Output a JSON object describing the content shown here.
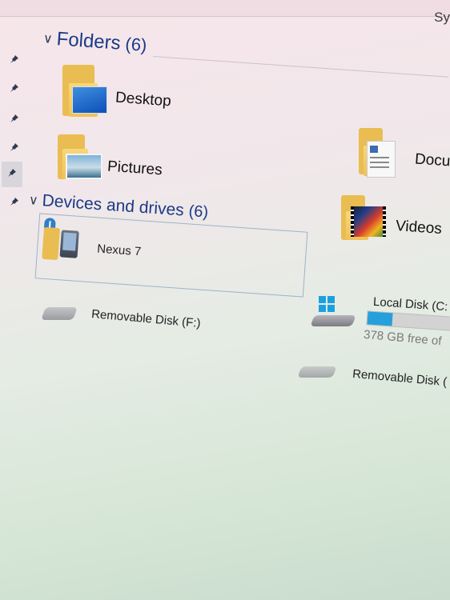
{
  "titlebar": {
    "partial_text": "Sy"
  },
  "folders": {
    "title": "Folders",
    "count": "(6)",
    "items": [
      {
        "label": "Desktop",
        "icon": "desktop-folder-icon"
      },
      {
        "label": "Pictures",
        "icon": "pictures-folder-icon"
      },
      {
        "label": "Docu",
        "icon": "documents-folder-icon"
      },
      {
        "label": "Videos",
        "icon": "videos-folder-icon"
      }
    ]
  },
  "devices": {
    "title": "Devices and drives",
    "count": "(6)",
    "items": [
      {
        "label": "Nexus 7",
        "icon": "bluetooth-tablet-icon",
        "selected": true
      },
      {
        "label": "Removable Disk (F:)",
        "icon": "removable-disk-icon"
      },
      {
        "label": "Local Disk (C:",
        "icon": "windows-drive-icon",
        "free_text": "378 GB free of ",
        "used_fraction": 0.3
      },
      {
        "label": "Removable Disk (",
        "icon": "removable-disk-icon"
      }
    ]
  },
  "nav_pins": [
    "pin-icon",
    "pin-icon",
    "pin-icon",
    "pin-icon",
    "pin-icon",
    "pin-icon"
  ],
  "colors": {
    "header_blue": "#1c3a87",
    "folder_yellow": "#f2c75c",
    "progress_blue": "#26a0da"
  }
}
